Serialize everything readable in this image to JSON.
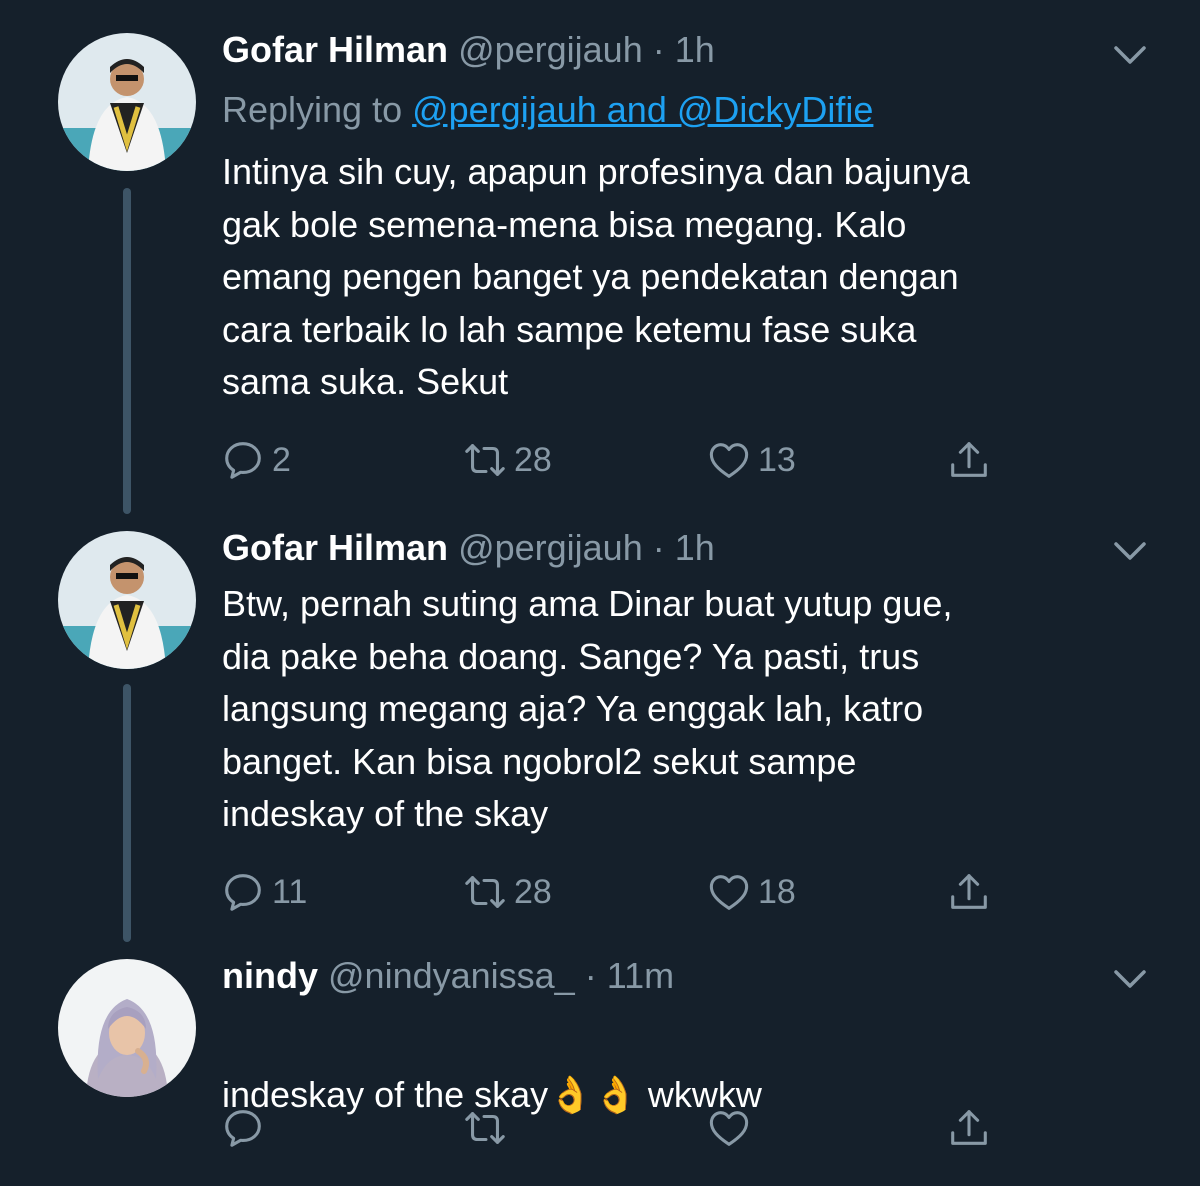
{
  "tweets": [
    {
      "name": "Gofar Hilman",
      "handle": "@pergijauh",
      "dot": "·",
      "time": "1h",
      "replying_prefix": "Replying to ",
      "replying_to": "@pergijauh and @DickyDifie",
      "text": "Intinya sih cuy, apapun profesinya dan bajunya\ngak bole semena-mena bisa megang. Kalo\nemang pengen banget ya pendekatan dengan\ncara terbaik lo lah sampe ketemu fase suka\nsama suka. Sekut",
      "reply_count": "2",
      "retweet_count": "28",
      "like_count": "13"
    },
    {
      "name": "Gofar Hilman",
      "handle": "@pergijauh",
      "dot": "·",
      "time": "1h",
      "text": "Btw, pernah suting ama Dinar buat yutup gue,\ndia pake beha doang. Sange? Ya pasti, trus\nlangsung megang aja? Ya enggak lah, katro\nbanget. Kan bisa ngobrol2 sekut sampe\nindeskay of the skay",
      "reply_count": "11",
      "retweet_count": "28",
      "like_count": "18"
    },
    {
      "name": "nindy",
      "handle": "@nindyanissa_",
      "dot": "·",
      "time": "11m",
      "text_main": "indeskay of the skay",
      "emoji": "👌👌",
      "text_tail": " wkwkw",
      "reply_count": "",
      "retweet_count": "",
      "like_count": ""
    }
  ],
  "icons": [
    "reply-icon",
    "retweet-icon",
    "like-icon",
    "share-icon",
    "chevron-down-icon"
  ],
  "colors": {
    "background": "#15202b",
    "secondary_text": "#8899a6",
    "link": "#1da1f2",
    "thread_line": "#3d5466"
  }
}
